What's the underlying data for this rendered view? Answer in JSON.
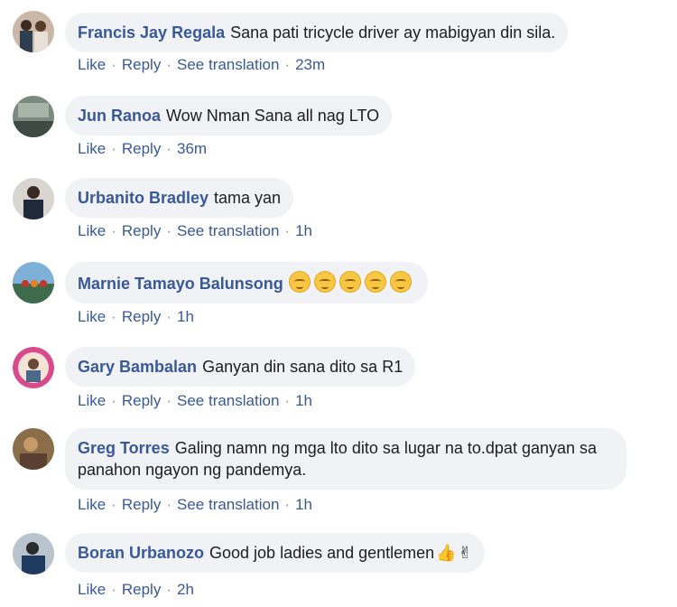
{
  "actions": {
    "like": "Like",
    "reply": "Reply",
    "see_translation": "See translation",
    "separator": "·"
  },
  "comments": [
    {
      "name": "Francis Jay Regala",
      "text": "Sana pati tricycle driver ay mabigyan din sila.",
      "time": "23m",
      "translation": true
    },
    {
      "name": "Jun Ranoa",
      "text": "Wow Nman Sana all nag LTO",
      "time": "36m",
      "translation": false
    },
    {
      "name": "Urbanito Bradley",
      "text": "tama yan",
      "time": "1h",
      "translation": true
    },
    {
      "name": "Marnie Tamayo Balunsong",
      "text": "",
      "time": "1h",
      "translation": false
    },
    {
      "name": "Gary Bambalan",
      "text": "Ganyan din sana dito sa R1",
      "time": "1h",
      "translation": true
    },
    {
      "name": "Greg Torres",
      "text": "Galing namn ng mga lto dito sa lugar na to.dpat ganyan sa panahon ngayon ng pandemya.",
      "time": "1h",
      "translation": true
    },
    {
      "name": "Boran Urbanozo",
      "text": "Good job ladies and gentlemen",
      "time": "2h",
      "translation": false
    }
  ]
}
